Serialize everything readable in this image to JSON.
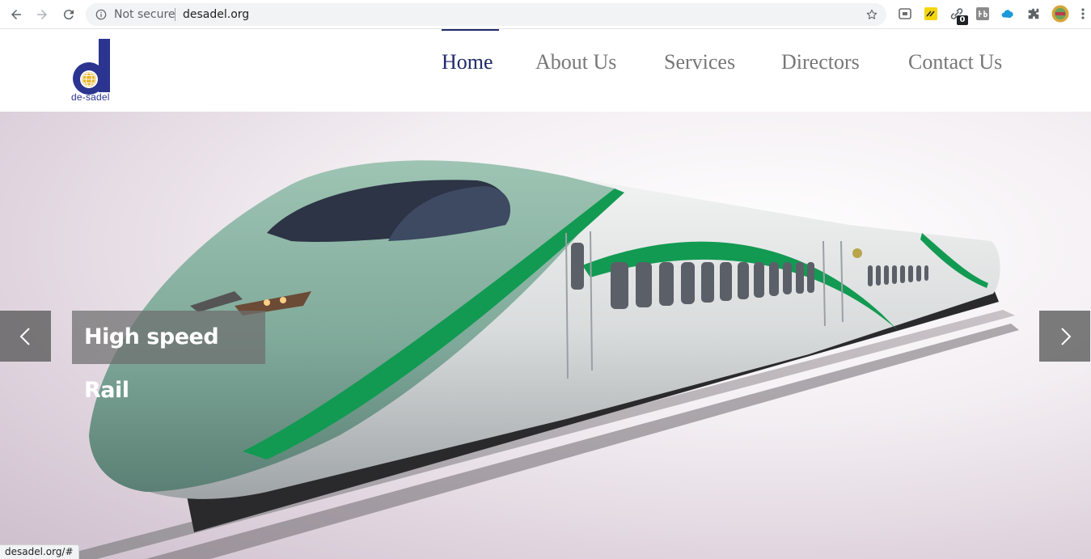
{
  "browser": {
    "security_label": "Not secure",
    "url": "desadel.org",
    "extension_badge": "0",
    "status_url": "desadel.org/#"
  },
  "site": {
    "logo_text": "de-sadel",
    "brand_color": "#2b3590",
    "nav": [
      {
        "label": "Home",
        "active": true
      },
      {
        "label": "About Us",
        "active": false
      },
      {
        "label": "Services",
        "active": false
      },
      {
        "label": "Directors",
        "active": false
      },
      {
        "label": "Contact Us",
        "active": false
      }
    ]
  },
  "slider": {
    "caption": "High speed Rail",
    "prev_icon": "chevron-left-icon",
    "next_icon": "chevron-right-icon"
  }
}
